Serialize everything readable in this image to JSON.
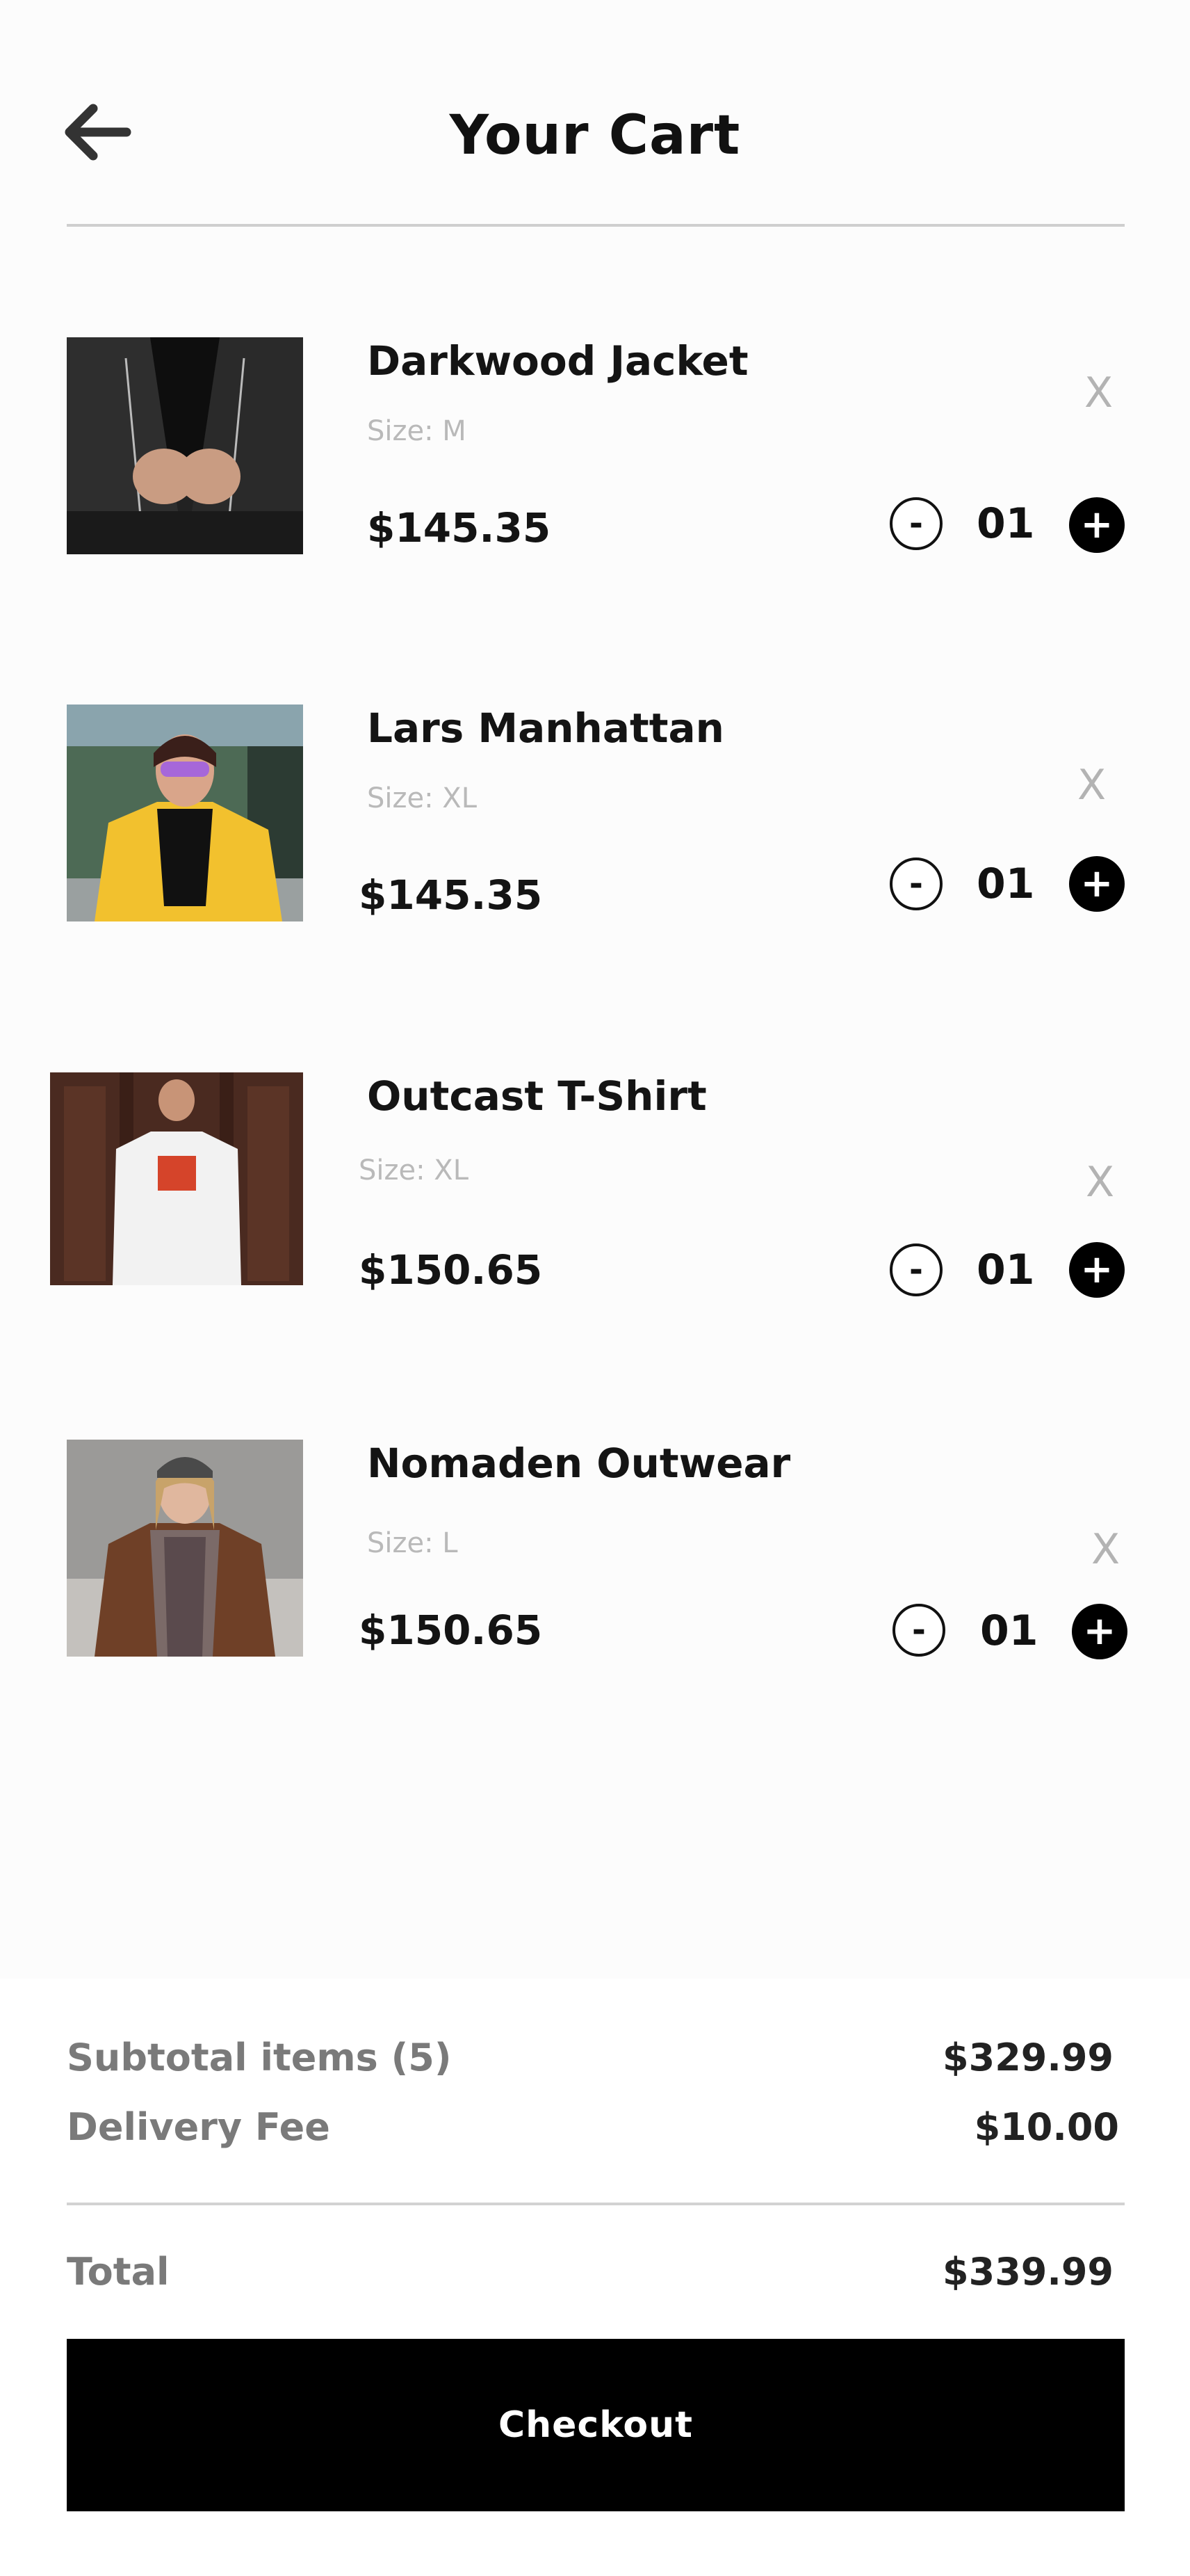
{
  "header": {
    "back_icon": "arrow-left-icon",
    "title": "Your Cart"
  },
  "cart": {
    "items": [
      {
        "name": "Darkwood Jacket",
        "size": "Size: M",
        "price": "$145.35",
        "quantity": "01",
        "remove": "X",
        "minus": "-",
        "plus": "+"
      },
      {
        "name": "Lars Manhattan",
        "size": "Size: XL",
        "price": "$145.35",
        "quantity": "01",
        "remove": "X",
        "minus": "-",
        "plus": "+"
      },
      {
        "name": "Outcast T-Shirt",
        "size": "Size: XL",
        "price": "$150.65",
        "quantity": "01",
        "remove": "X",
        "minus": "-",
        "plus": "+"
      },
      {
        "name": "Nomaden Outwear",
        "size": "Size: L",
        "price": "$150.65",
        "quantity": "01",
        "remove": "X",
        "minus": "-",
        "plus": "+"
      }
    ]
  },
  "summary": {
    "subtotal_label": "Subtotal items (5)",
    "subtotal_value": "$329.99",
    "delivery_label": "Delivery Fee",
    "delivery_value": "$10.00",
    "total_label": "Total",
    "total_value": "$339.99",
    "checkout_label": "Checkout"
  },
  "colors": {
    "accent": "#000000",
    "background": "#fcfcfc",
    "muted_text": "#b9b9b9"
  }
}
